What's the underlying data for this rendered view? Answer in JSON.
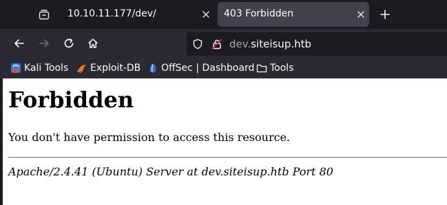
{
  "tabs": [
    {
      "title": "10.10.11.177/dev/",
      "active": false
    },
    {
      "title": "403 Forbidden",
      "active": true
    }
  ],
  "toolbar": {
    "tabs_list_icon": "tabs-list-icon",
    "new_tab_icon": "plus-icon",
    "back_icon": "arrow-left-icon",
    "forward_icon": "arrow-right-icon",
    "reload_icon": "reload-icon",
    "home_icon": "home-icon"
  },
  "urlbar": {
    "subdomain": "dev.",
    "domain": "siteisup.htb"
  },
  "bookmarks": [
    {
      "label": "Kali Tools",
      "icon": "kali-icon"
    },
    {
      "label": "Exploit-DB",
      "icon": "exploitdb-icon"
    },
    {
      "label": "OffSec | Dashboard",
      "icon": "offsec-icon"
    },
    {
      "label": "Tools",
      "icon": "folder-icon"
    }
  ],
  "page": {
    "heading": "Forbidden",
    "message": "You don't have permission to access this resource.",
    "signature": "Apache/2.4.41 (Ubuntu) Server at dev.siteisup.htb Port 80"
  },
  "colors": {
    "chrome_dark": "#1c1b22",
    "toolbar": "#2b2a33",
    "active_tab": "#42414d",
    "page_bg": "#ffffff"
  }
}
